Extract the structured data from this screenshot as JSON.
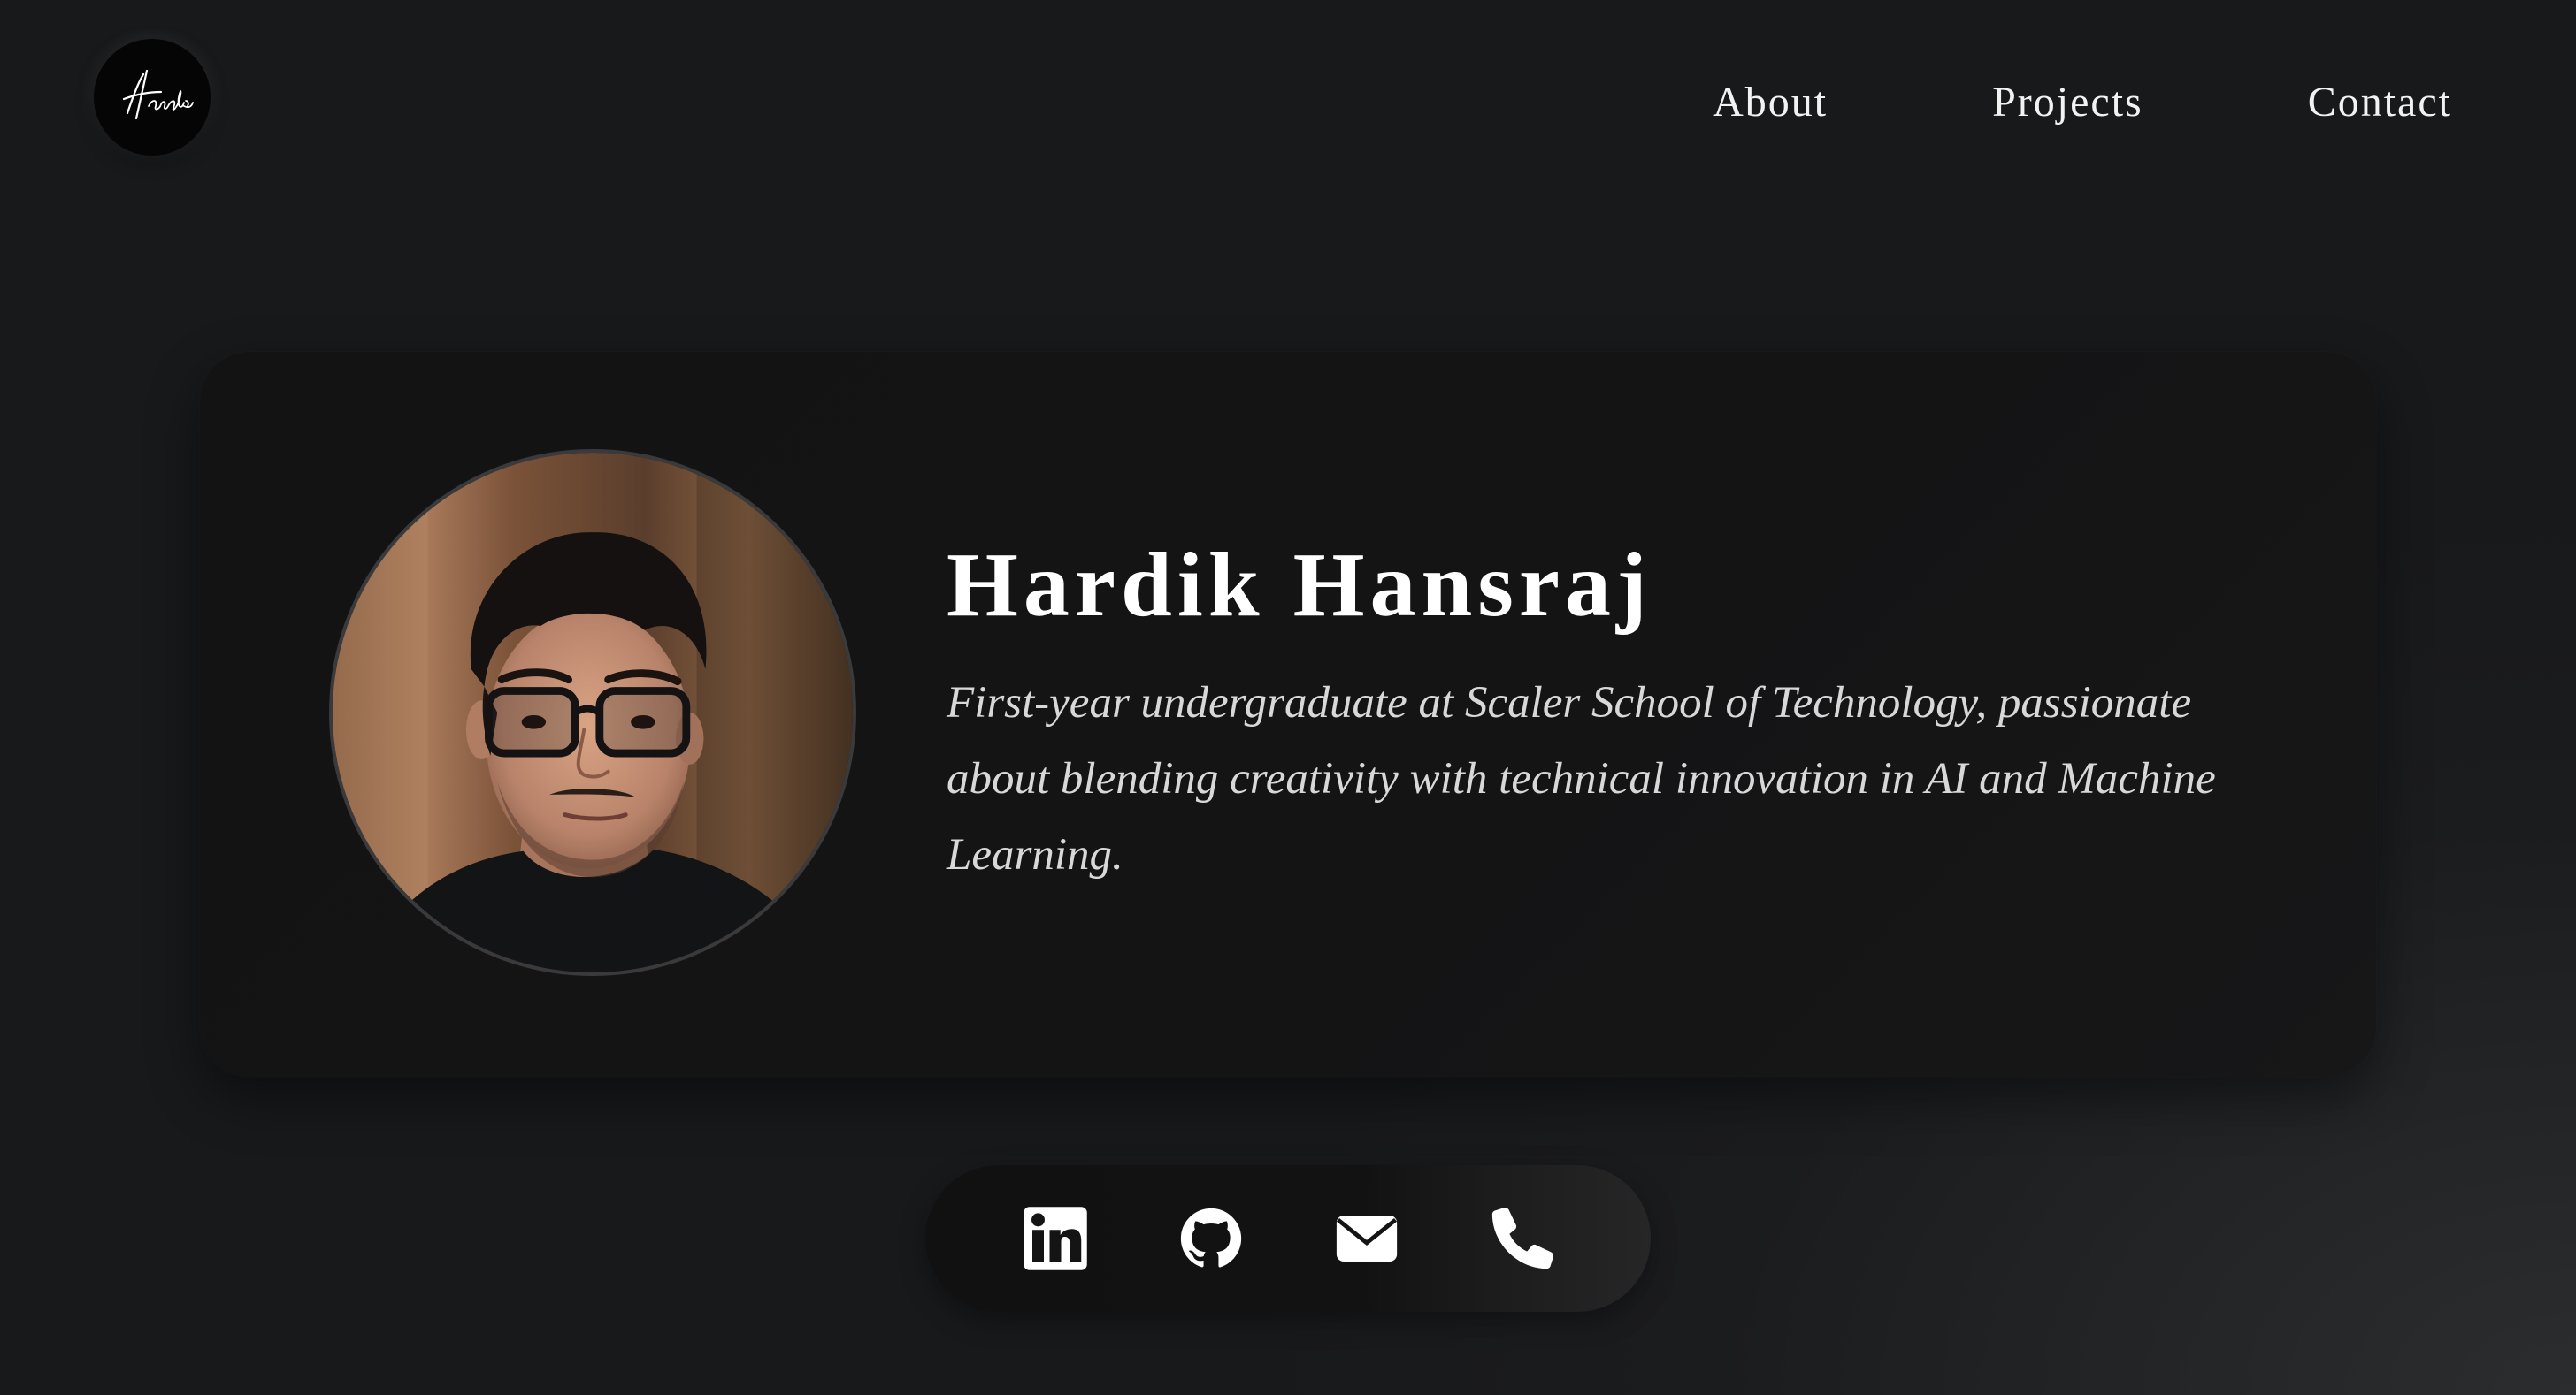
{
  "header": {
    "logo_signature": "Hardik",
    "nav": [
      {
        "label": "About"
      },
      {
        "label": "Projects"
      },
      {
        "label": "Contact"
      }
    ]
  },
  "hero": {
    "name": "Hardik Hansraj",
    "bio": "First-year undergraduate at Scaler School of Technology, passionate about blending creativity with technical innovation in AI and Machine Learning.",
    "avatar_icon": "profile-photo"
  },
  "social": [
    {
      "icon": "linkedin-icon"
    },
    {
      "icon": "github-icon"
    },
    {
      "icon": "email-icon"
    },
    {
      "icon": "phone-icon"
    }
  ],
  "colors": {
    "background": "#18191b",
    "card": "#141415",
    "text": "#ffffff",
    "muted_text": "#d8d8d8"
  }
}
